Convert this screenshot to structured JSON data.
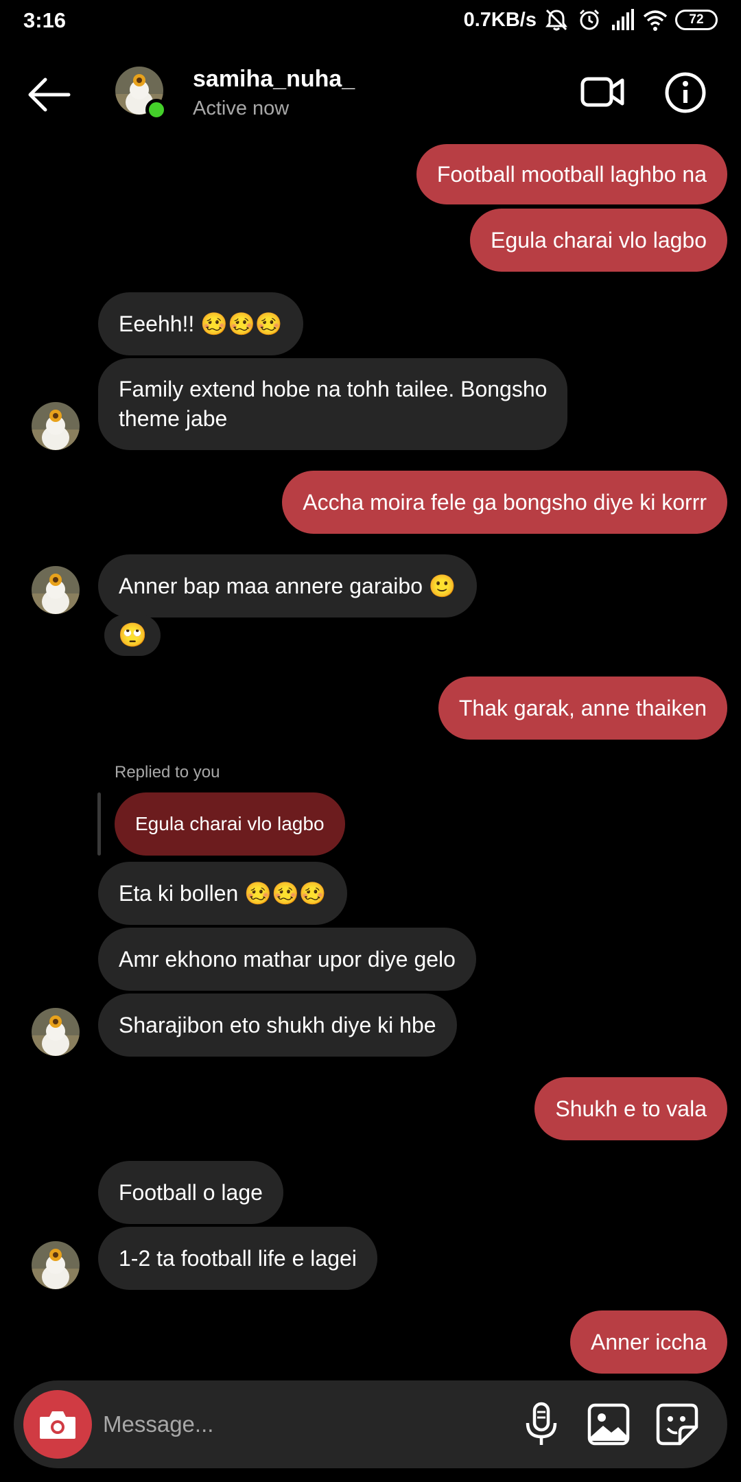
{
  "status_bar": {
    "time": "3:16",
    "net_speed": "0.7KB/s",
    "battery": "72"
  },
  "header": {
    "username": "samiha_nuha_",
    "status": "Active now",
    "online_color": "#44d02a"
  },
  "colors": {
    "outgoing_bubble": "#b83e44",
    "incoming_bubble": "#262626",
    "reply_bubble": "#6c1c1e",
    "background": "#000000"
  },
  "messages": [
    {
      "direction": "out",
      "text": "Football mootball laghbo na"
    },
    {
      "direction": "out",
      "text": "Egula charai vlo lagbo"
    },
    {
      "direction": "in",
      "text": "Eeehh!! 🥴🥴🥴"
    },
    {
      "direction": "in",
      "text": "Family extend hobe na tohh tailee. Bongsho\ntheme jabe"
    },
    {
      "direction": "out",
      "text": "Accha moira fele ga bongsho diye ki korrr"
    },
    {
      "direction": "in",
      "text": "Anner bap maa annere garaibo 🙂"
    },
    {
      "direction": "in",
      "text": "🙄"
    },
    {
      "direction": "out",
      "text": "Thak garak, anne thaiken"
    },
    {
      "direction": "in",
      "text": "Eta ki bollen 🥴🥴🥴"
    },
    {
      "direction": "in",
      "text": "Amr ekhono mathar upor diye gelo"
    },
    {
      "direction": "in",
      "text": "Sharajibon eto shukh diye ki hbe"
    },
    {
      "direction": "out",
      "text": "Shukh e to vala"
    },
    {
      "direction": "in",
      "text": "Football o lage"
    },
    {
      "direction": "in",
      "text": "1-2 ta football life e lagei"
    },
    {
      "direction": "out",
      "text": "Anner iccha"
    }
  ],
  "reply": {
    "label": "Replied to you",
    "quoted_text": "Egula charai vlo lagbo"
  },
  "composer": {
    "placeholder": "Message..."
  },
  "icons": {
    "back": "arrow-left-icon",
    "video": "video-call-icon",
    "info": "info-icon",
    "camera": "camera-icon",
    "mic": "microphone-icon",
    "gallery": "gallery-icon",
    "sticker": "sticker-icon"
  }
}
